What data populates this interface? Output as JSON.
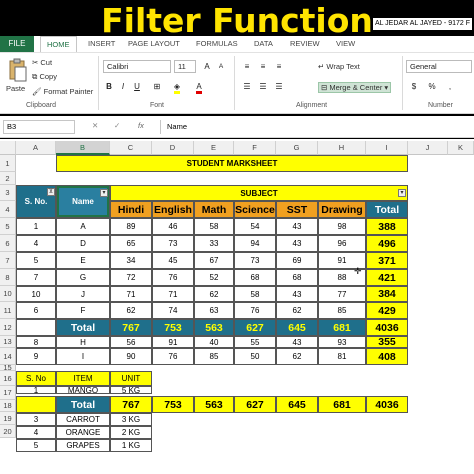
{
  "overlay_title": "Filter Function",
  "window_title": "AL JEDAR AL JAYED - 9172 F",
  "tabs": [
    "FILE",
    "HOME",
    "INSERT",
    "PAGE LAYOUT",
    "FORMULAS",
    "DATA",
    "REVIEW",
    "VIEW"
  ],
  "ribbon": {
    "paste": "Paste",
    "cut": "Cut",
    "copy": "Copy",
    "format_painter": "Format Painter",
    "clipboard": "Clipboard",
    "font_name": "Calibri",
    "font_size": "11",
    "font": "Font",
    "bold": "B",
    "italic": "I",
    "underline": "U",
    "wrap_text": "Wrap Text",
    "merge_center": "Merge & Center",
    "alignment": "Alignment",
    "number_format": "General",
    "number": "Number"
  },
  "formula_bar": {
    "name_box": "B3",
    "fx": "fx",
    "content": "Name"
  },
  "columns": [
    "A",
    "B",
    "C",
    "D",
    "E",
    "F",
    "G",
    "H",
    "I",
    "J",
    "K"
  ],
  "rows": [
    "1",
    "2",
    "3",
    "4",
    "5",
    "6",
    "7",
    "8",
    "10",
    "11",
    "12",
    "13",
    "14",
    "15",
    "16",
    "17",
    "18",
    "19",
    "20"
  ],
  "sheet": {
    "main_title": "STUDENT MARKSHEET",
    "sno_header": "S. No.",
    "name_header": "Name",
    "subject_header": "SUBJECT",
    "subjects": [
      "Hindi",
      "English",
      "Math",
      "Science",
      "SST",
      "Drawing",
      "Total"
    ],
    "students": [
      {
        "sno": "1",
        "name": "A",
        "marks": [
          "89",
          "46",
          "58",
          "54",
          "43",
          "98"
        ],
        "total": "388"
      },
      {
        "sno": "4",
        "name": "D",
        "marks": [
          "65",
          "73",
          "33",
          "94",
          "43",
          "96"
        ],
        "total": "496"
      },
      {
        "sno": "5",
        "name": "E",
        "marks": [
          "34",
          "45",
          "67",
          "73",
          "69",
          "91"
        ],
        "total": "371"
      },
      {
        "sno": "7",
        "name": "G",
        "marks": [
          "72",
          "76",
          "52",
          "68",
          "68",
          "88"
        ],
        "total": "421"
      },
      {
        "sno": "10",
        "name": "J",
        "marks": [
          "71",
          "71",
          "62",
          "58",
          "43",
          "77"
        ],
        "total": "384"
      },
      {
        "sno": "6",
        "name": "F",
        "marks": [
          "62",
          "74",
          "63",
          "76",
          "62",
          "85"
        ],
        "total": "429"
      }
    ],
    "total_label": "Total",
    "totals": [
      "767",
      "753",
      "563",
      "627",
      "645",
      "681",
      "4036"
    ],
    "filtered_students": [
      {
        "sno": "8",
        "name": "H",
        "marks": [
          "56",
          "91",
          "40",
          "55",
          "43",
          "93"
        ],
        "total": "355"
      },
      {
        "sno": "9",
        "name": "I",
        "marks": [
          "90",
          "76",
          "85",
          "50",
          "62",
          "81"
        ],
        "total": "408"
      }
    ],
    "item_headers": [
      "S. No",
      "ITEM",
      "UNIT"
    ],
    "items": [
      {
        "sno": "1",
        "item": "MANGO",
        "unit": "5 KG"
      },
      {
        "sno": "3",
        "item": "CARROT",
        "unit": "3 KG"
      },
      {
        "sno": "4",
        "item": "ORANGE",
        "unit": "2 KG"
      },
      {
        "sno": "5",
        "item": "GRAPES",
        "unit": "1 KG"
      }
    ]
  },
  "colors": {
    "yellow": "#ffff00",
    "orange": "#f0a020",
    "teal": "#1f6f8b",
    "excel_green": "#217346"
  }
}
